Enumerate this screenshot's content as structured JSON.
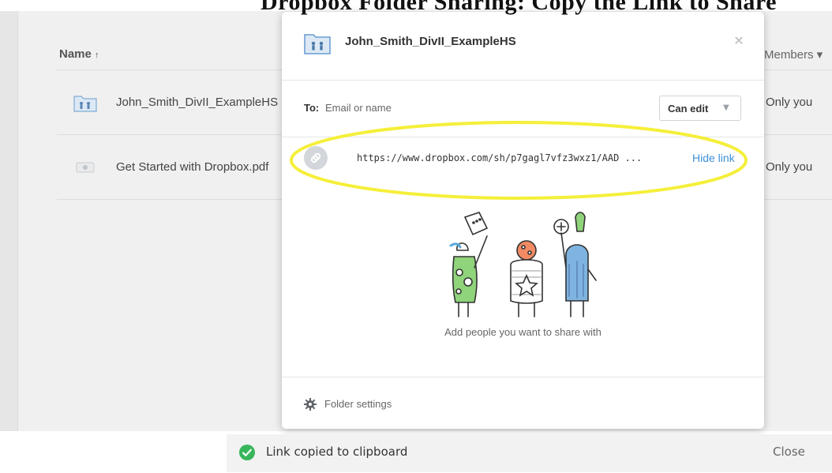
{
  "background": {
    "top_title": "Dropbox Folder Sharing: Copy the Link to Share",
    "table_header": {
      "name": "Name",
      "sort_arrow": "↑",
      "members": "Members ▾"
    },
    "rows": [
      {
        "name": "John_Smith_DivII_ExampleHS",
        "members": "Only you",
        "icon": "shared-folder-icon"
      },
      {
        "name": "Get Started with Dropbox.pdf",
        "members": "Only you",
        "icon": "pdf-file-icon"
      }
    ]
  },
  "modal": {
    "folder_icon": "shared-folder-icon",
    "title": "John_Smith_DivII_ExampleHS",
    "close_icon": "close-icon",
    "close_glyph": "✕",
    "to_label": "To:",
    "to_placeholder": "Email or name",
    "permission": "Can edit",
    "permission_caret": "▼",
    "link_url": "https://www.dropbox.com/sh/p7gagl7vfz3wxz1/AAD ...",
    "hide_link": "Hide link",
    "empty_text": "Add people you want to share with",
    "footer_label": "Folder settings"
  },
  "toast": {
    "message": "Link copied to clipboard",
    "close": "Close"
  },
  "colors": {
    "accent": "#3d8fd8",
    "highlight": "#f5ef3a",
    "success": "#38b65b"
  }
}
